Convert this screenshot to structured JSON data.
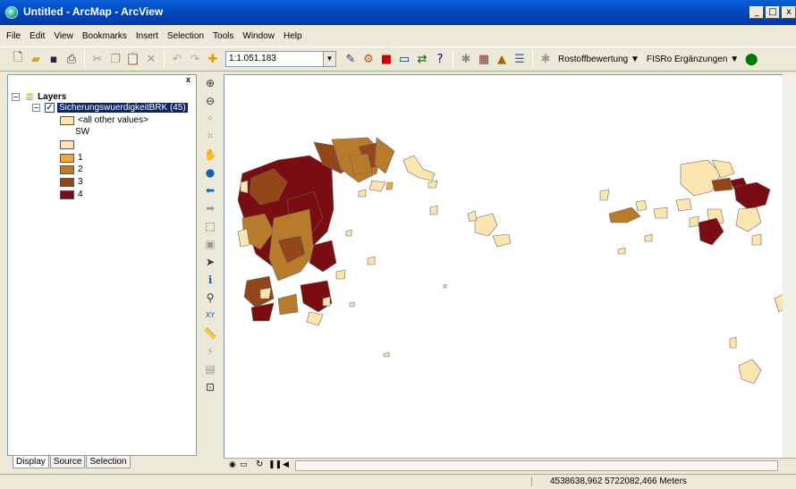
{
  "window": {
    "title": "Untitled - ArcMap - ArcView",
    "min": "_",
    "max": "□",
    "close": "x"
  },
  "menu": [
    "File",
    "Edit",
    "View",
    "Bookmarks",
    "Insert",
    "Selection",
    "Tools",
    "Window",
    "Help"
  ],
  "toolbar": {
    "scale_value": "1:1.051.183",
    "scale_dropdown": "▼",
    "rostoff_label": "Rostoffbewertung ▼",
    "fisro_label": "FISRo Ergänzungen ▼"
  },
  "toc": {
    "close": "x",
    "layers_label": "Layers",
    "layer_name": "SicherungswuerdigkeitBRK (45)",
    "expand_minus": "−",
    "checked": "✓",
    "legend": [
      {
        "label": "<all other values>",
        "color": "#fce5b0"
      },
      {
        "label": "SW",
        "color": ""
      },
      {
        "label": "",
        "color": "#fce5b0"
      },
      {
        "label": "1",
        "color": "#f5a733"
      },
      {
        "label": "2",
        "color": "#b87b2c"
      },
      {
        "label": "3",
        "color": "#94461b"
      },
      {
        "label": "4",
        "color": "#7a0d12"
      }
    ]
  },
  "tabs": [
    "Display",
    "Source",
    "Selection"
  ],
  "status": {
    "coords": "4538638,962  5722082,466 Meters"
  },
  "colors": {
    "c0": "#fce5b0",
    "c1": "#f5a733",
    "c2": "#b87b2c",
    "c3": "#94461b",
    "c4": "#7a0d12"
  }
}
